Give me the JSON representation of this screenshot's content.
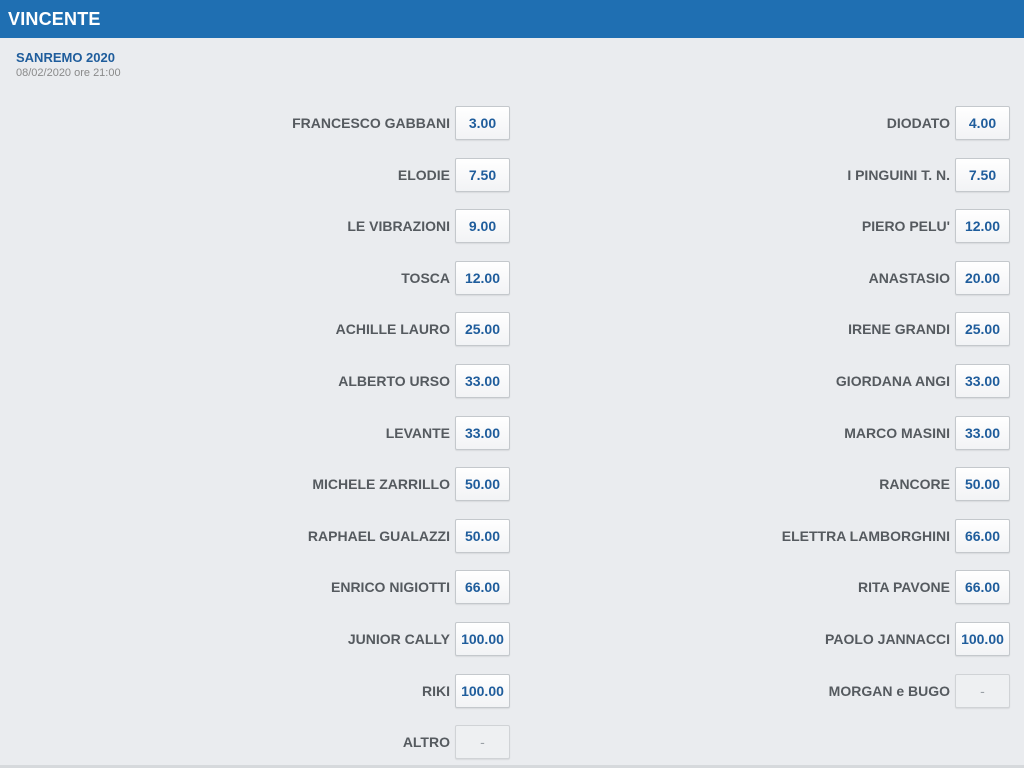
{
  "header": {
    "title": "VINCENTE"
  },
  "event": {
    "title": "SANREMO 2020",
    "date": "08/02/2020 ore 21:00"
  },
  "left_column": [
    {
      "name": "FRANCESCO GABBANI",
      "odd": "3.00",
      "enabled": true
    },
    {
      "name": "ELODIE",
      "odd": "7.50",
      "enabled": true
    },
    {
      "name": "LE VIBRAZIONI",
      "odd": "9.00",
      "enabled": true
    },
    {
      "name": "TOSCA",
      "odd": "12.00",
      "enabled": true
    },
    {
      "name": "ACHILLE LAURO",
      "odd": "25.00",
      "enabled": true
    },
    {
      "name": "ALBERTO URSO",
      "odd": "33.00",
      "enabled": true
    },
    {
      "name": "LEVANTE",
      "odd": "33.00",
      "enabled": true
    },
    {
      "name": "MICHELE ZARRILLO",
      "odd": "50.00",
      "enabled": true
    },
    {
      "name": "RAPHAEL GUALAZZI",
      "odd": "50.00",
      "enabled": true
    },
    {
      "name": "ENRICO NIGIOTTI",
      "odd": "66.00",
      "enabled": true
    },
    {
      "name": "JUNIOR CALLY",
      "odd": "100.00",
      "enabled": true
    },
    {
      "name": "RIKI",
      "odd": "100.00",
      "enabled": true
    },
    {
      "name": "ALTRO",
      "odd": "-",
      "enabled": false
    }
  ],
  "right_column": [
    {
      "name": "DIODATO",
      "odd": "4.00",
      "enabled": true
    },
    {
      "name": "I PINGUINI T. N.",
      "odd": "7.50",
      "enabled": true
    },
    {
      "name": "PIERO PELU'",
      "odd": "12.00",
      "enabled": true
    },
    {
      "name": "ANASTASIO",
      "odd": "20.00",
      "enabled": true
    },
    {
      "name": "IRENE GRANDI",
      "odd": "25.00",
      "enabled": true
    },
    {
      "name": "GIORDANA ANGI",
      "odd": "33.00",
      "enabled": true
    },
    {
      "name": "MARCO MASINI",
      "odd": "33.00",
      "enabled": true
    },
    {
      "name": "RANCORE",
      "odd": "50.00",
      "enabled": true
    },
    {
      "name": "ELETTRA LAMBORGHINI",
      "odd": "66.00",
      "enabled": true
    },
    {
      "name": "RITA PAVONE",
      "odd": "66.00",
      "enabled": true
    },
    {
      "name": "PAOLO JANNACCI",
      "odd": "100.00",
      "enabled": true
    },
    {
      "name": "MORGAN e BUGO",
      "odd": "-",
      "enabled": false
    }
  ]
}
